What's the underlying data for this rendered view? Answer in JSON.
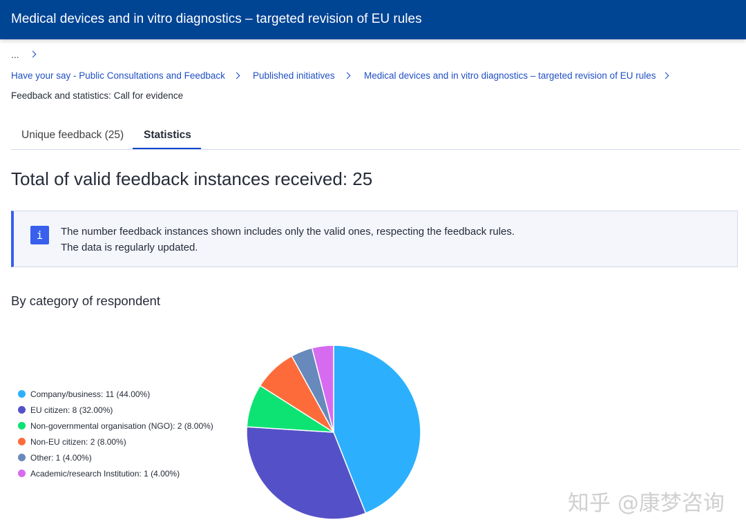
{
  "header": {
    "title": "Medical devices and in vitro diagnostics – targeted revision of EU rules"
  },
  "breadcrumb": {
    "ellipsis": "...",
    "items": [
      "Have your say - Public Consultations and Feedback",
      "Published initiatives",
      "Medical devices and in vitro diagnostics – targeted revision of EU rules"
    ],
    "current": "Feedback and statistics: Call for evidence"
  },
  "tabs": [
    {
      "label": "Unique feedback (25)",
      "active": false
    },
    {
      "label": "Statistics",
      "active": true
    }
  ],
  "main": {
    "total_heading": "Total of valid feedback instances received: 25",
    "notice": {
      "icon": "info-icon",
      "icon_glyph": "i",
      "line1": "The number feedback instances shown includes only the valid ones, respecting the feedback rules.",
      "line2": "The data is regularly updated."
    },
    "section_title": "By category of respondent"
  },
  "chart_data": {
    "type": "pie",
    "title": "",
    "legend_position": "left",
    "categories": [
      "Company/business",
      "EU citizen",
      "Non-governmental organisation (NGO)",
      "Non-EU citizen",
      "Other",
      "Academic/research Institution"
    ],
    "values": [
      11,
      8,
      2,
      2,
      1,
      1
    ],
    "percents": [
      44.0,
      32.0,
      8.0,
      8.0,
      4.0,
      4.0
    ],
    "colors": [
      "#2cb0fd",
      "#5451c8",
      "#0de373",
      "#fe6b3a",
      "#6789bb",
      "#d76bf0"
    ],
    "legend_labels": [
      "Company/business: 11 (44.00%)",
      "EU citizen: 8 (32.00%)",
      "Non-governmental organisation (NGO): 2 (8.00%)",
      "Non-EU citizen: 2 (8.00%)",
      "Other: 1 (4.00%)",
      "Academic/research Institution: 1 (4.00%)"
    ]
  },
  "watermark": "知乎 @康梦咨询"
}
